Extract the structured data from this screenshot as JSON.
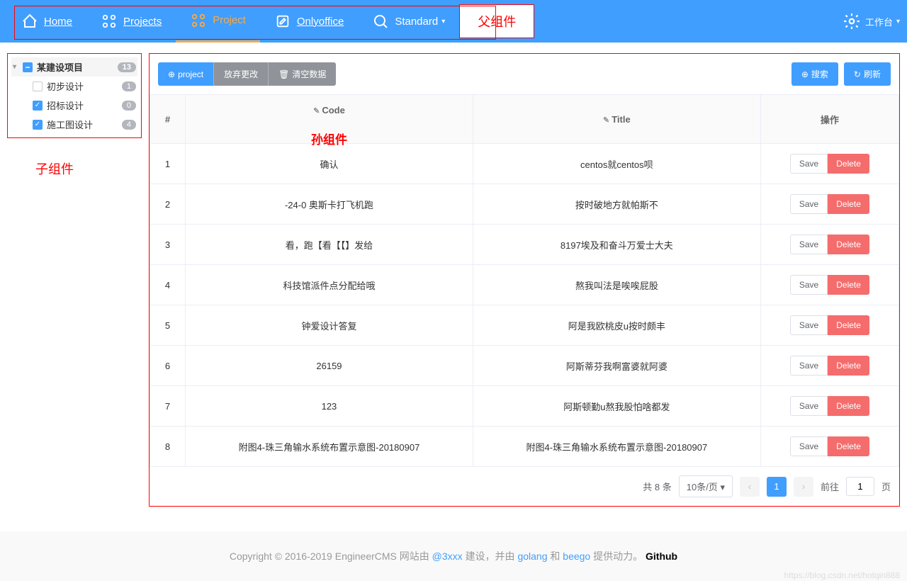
{
  "nav": {
    "home": "Home",
    "projects": "Projects",
    "project": "Project",
    "onlyoffice": "Onlyoffice",
    "standard": "Standard",
    "parent_label": "父组件",
    "workbench": "工作台"
  },
  "sidebar": {
    "root": {
      "label": "某建设项目",
      "count": "13"
    },
    "items": [
      {
        "label": "初步设计",
        "count": "1",
        "checked": false
      },
      {
        "label": "招标设计",
        "count": "0",
        "checked": true
      },
      {
        "label": "施工图设计",
        "count": "4",
        "checked": true
      }
    ],
    "child_label": "子组件"
  },
  "toolbar": {
    "project": "project",
    "discard": "放弃更改",
    "clear": "清空数据",
    "search": "搜索",
    "refresh": "刷新"
  },
  "table": {
    "grandchild_label": "孙组件",
    "headers": {
      "num": "#",
      "code": "Code",
      "title": "Title",
      "action": "操作"
    },
    "save": "Save",
    "delete": "Delete",
    "rows": [
      {
        "n": "1",
        "code": "确认",
        "title": "centos就centos呗"
      },
      {
        "n": "2",
        "code": "-24-0 奥斯卡打飞机跑",
        "title": "按时破地方就帕斯不"
      },
      {
        "n": "3",
        "code": "看，跑【看【【】发给",
        "title": "8197埃及和奋斗万爱士大夫"
      },
      {
        "n": "4",
        "code": "科技馆派件点分配给哦",
        "title": "熬我叫法是唉唉屁股"
      },
      {
        "n": "5",
        "code": "钟爱设计答复",
        "title": "阿是我欧桃皮u按时颇丰"
      },
      {
        "n": "6",
        "code": "26159",
        "title": "阿斯蒂芬我啊富婆就阿婆"
      },
      {
        "n": "7",
        "code": "123",
        "title": "阿斯顿勤u熬我股怕啥都发"
      },
      {
        "n": "8",
        "code": "附图4-珠三角输水系统布置示意图-20180907",
        "title": "附图4-珠三角输水系统布置示意图-20180907"
      }
    ]
  },
  "pagination": {
    "total": "共 8 条",
    "per_page": "10条/页",
    "current": "1",
    "goto": "前往",
    "page_suffix": "页",
    "goto_value": "1"
  },
  "footer": {
    "copyright": "Copyright © 2016-2019 EngineerCMS 网站由 ",
    "author": "@3xxx",
    "mid1": " 建设，并由 ",
    "golang": "golang",
    "mid2": " 和 ",
    "beego": "beego",
    "end": " 提供动力。 ",
    "github": "Github",
    "watermark": "https://blog.csdn.net/hotqin888"
  }
}
